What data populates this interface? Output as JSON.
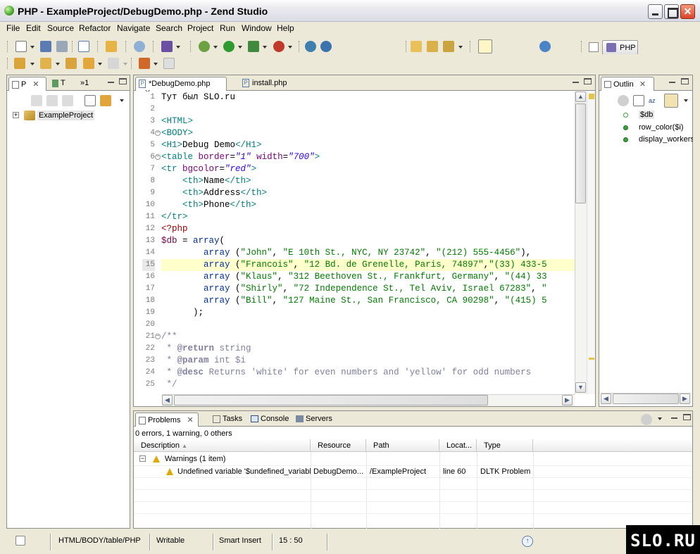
{
  "window": {
    "title": "PHP - ExampleProject/DebugDemo.php - Zend Studio"
  },
  "menu": [
    "File",
    "Edit",
    "Source",
    "Refactor",
    "Navigate",
    "Search",
    "Project",
    "Run",
    "Window",
    "Help"
  ],
  "perspective": {
    "label": "PHP"
  },
  "package_explorer": {
    "tabs": [
      "P",
      "T",
      "1"
    ],
    "project": "ExampleProject"
  },
  "editor": {
    "tabs": [
      {
        "label": "*DebugDemo.php",
        "active": true
      },
      {
        "label": "install.php",
        "active": false
      }
    ],
    "current_line": 15,
    "lines": [
      [
        [
          "p",
          "Тут был SLO.ru"
        ]
      ],
      [],
      [
        [
          "tag",
          "<HTML>"
        ]
      ],
      [
        [
          "tag",
          "<BODY>"
        ]
      ],
      [
        [
          "tag",
          "<H1>"
        ],
        [
          "p",
          "Debug Demo"
        ],
        [
          "tag",
          "</H1>"
        ]
      ],
      [
        [
          "tag",
          "<table "
        ],
        [
          "attr",
          "border"
        ],
        [
          "p",
          "="
        ],
        [
          "str",
          "\"1\""
        ],
        [
          "p",
          " "
        ],
        [
          "attr",
          "width"
        ],
        [
          "p",
          "="
        ],
        [
          "str",
          "\"700\""
        ],
        [
          "tag",
          ">"
        ]
      ],
      [
        [
          "tag",
          "<tr "
        ],
        [
          "attr",
          "bgcolor"
        ],
        [
          "p",
          "="
        ],
        [
          "str",
          "\"red\""
        ],
        [
          "tag",
          ">"
        ]
      ],
      [
        [
          "p",
          "    "
        ],
        [
          "tag",
          "<th>"
        ],
        [
          "p",
          "Name"
        ],
        [
          "tag",
          "</th>"
        ]
      ],
      [
        [
          "p",
          "    "
        ],
        [
          "tag",
          "<th>"
        ],
        [
          "p",
          "Address"
        ],
        [
          "tag",
          "</th>"
        ]
      ],
      [
        [
          "p",
          "    "
        ],
        [
          "tag",
          "<th>"
        ],
        [
          "p",
          "Phone"
        ],
        [
          "tag",
          "</th>"
        ]
      ],
      [
        [
          "tag",
          "</tr>"
        ]
      ],
      [
        [
          "php",
          "<?php"
        ]
      ],
      [
        [
          "var",
          "$db"
        ],
        [
          "p",
          " = "
        ],
        [
          "kw",
          "array"
        ],
        [
          "p",
          "("
        ]
      ],
      [
        [
          "p",
          "        "
        ],
        [
          "kw",
          "array"
        ],
        [
          "p",
          " ("
        ],
        [
          "pstr",
          "\"John\""
        ],
        [
          "p",
          ", "
        ],
        [
          "pstr",
          "\"E 10th St., NYC, NY 23742\""
        ],
        [
          "p",
          ", "
        ],
        [
          "pstr",
          "\"(212) 555-4456\""
        ],
        [
          "p",
          "),"
        ]
      ],
      [
        [
          "p",
          "        "
        ],
        [
          "kw",
          "array"
        ],
        [
          "p",
          " ("
        ],
        [
          "pstr",
          "\"Francois\""
        ],
        [
          "p",
          ", "
        ],
        [
          "pstr",
          "\"12 Bd. de Grenelle, Paris, 74897\""
        ],
        [
          "p",
          ","
        ],
        [
          "pstr",
          "\"(33) 433-5"
        ]
      ],
      [
        [
          "p",
          "        "
        ],
        [
          "kw",
          "array"
        ],
        [
          "p",
          " ("
        ],
        [
          "pstr",
          "\"Klaus\""
        ],
        [
          "p",
          ", "
        ],
        [
          "pstr",
          "\"312 Beethoven St., Frankfurt, Germany\""
        ],
        [
          "p",
          ", "
        ],
        [
          "pstr",
          "\"(44) 33"
        ]
      ],
      [
        [
          "p",
          "        "
        ],
        [
          "kw",
          "array"
        ],
        [
          "p",
          " ("
        ],
        [
          "pstr",
          "\"Shirly\""
        ],
        [
          "p",
          ", "
        ],
        [
          "pstr",
          "\"72 Independence St., Tel Aviv, Israel 67283\""
        ],
        [
          "p",
          ", "
        ],
        [
          "pstr",
          "\""
        ]
      ],
      [
        [
          "p",
          "        "
        ],
        [
          "kw",
          "array"
        ],
        [
          "p",
          " ("
        ],
        [
          "pstr",
          "\"Bill\""
        ],
        [
          "p",
          ", "
        ],
        [
          "pstr",
          "\"127 Maine St., San Francisco, CA 90298\""
        ],
        [
          "p",
          ", "
        ],
        [
          "pstr",
          "\"(415) 5"
        ]
      ],
      [
        [
          "p",
          "      );"
        ]
      ],
      [],
      [
        [
          "cmt",
          "/**"
        ]
      ],
      [
        [
          "cmt",
          " * "
        ],
        [
          "doc",
          "@return"
        ],
        [
          "cmt",
          " string"
        ]
      ],
      [
        [
          "cmt",
          " * "
        ],
        [
          "doc",
          "@param"
        ],
        [
          "cmt",
          " int $i"
        ]
      ],
      [
        [
          "cmt",
          " * "
        ],
        [
          "doc",
          "@desc"
        ],
        [
          "cmt",
          " Returns 'white' for even numbers and 'yellow' for odd numbers"
        ]
      ],
      [
        [
          "cmt",
          " */"
        ]
      ]
    ]
  },
  "outline": {
    "tab": "Outlin",
    "items": [
      "$db",
      "row_color($i)",
      "display_workers"
    ]
  },
  "problems_view": {
    "tabs": [
      "Problems",
      "Tasks",
      "Console",
      "Servers"
    ],
    "summary": "0 errors, 1 warning, 0 others",
    "columns": [
      "Description",
      "Resource",
      "Path",
      "Locat...",
      "Type"
    ],
    "group": "Warnings (1 item)",
    "rows": [
      {
        "description": "Undefined variable '$undefined_variabl",
        "resource": "DebugDemo...",
        "path": "/ExampleProject",
        "location": "line 60",
        "type": "DLTK Problem"
      }
    ]
  },
  "statusbar": {
    "path": "HTML/BODY/table/PHP",
    "mode": "Writable",
    "insert": "Smart Insert",
    "position": "15 : 50"
  },
  "watermark": "SLO.RU",
  "colors": {
    "tag": "#008080",
    "attr": "#7f007f",
    "string": "#2a00ff",
    "php_string": "#007e00",
    "keyword": "#0030a0",
    "variable": "#7a0045",
    "comment": "#7f7f9f",
    "current_line": "#ffffcc"
  }
}
